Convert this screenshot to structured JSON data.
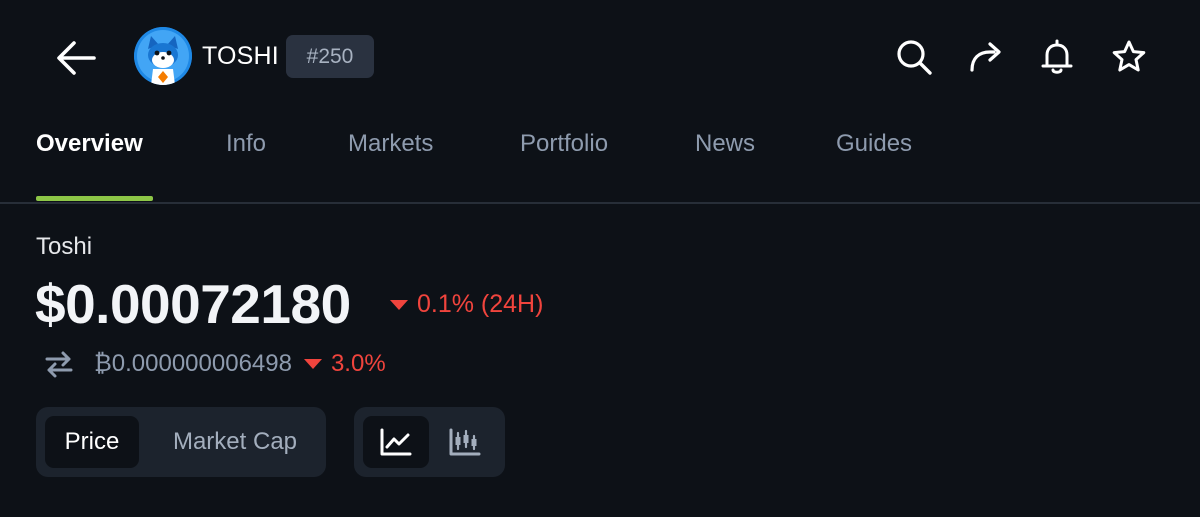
{
  "header": {
    "coin_symbol": "TOSHI",
    "rank": "#250",
    "icons": [
      "back-arrow-icon",
      "search-icon",
      "share-icon",
      "bell-icon",
      "star-icon"
    ]
  },
  "tabs": [
    {
      "label": "Overview",
      "active": true
    },
    {
      "label": "Info",
      "active": false
    },
    {
      "label": "Markets",
      "active": false
    },
    {
      "label": "Portfolio",
      "active": false
    },
    {
      "label": "News",
      "active": false
    },
    {
      "label": "Guides",
      "active": false
    }
  ],
  "price_section": {
    "coin_name": "Toshi",
    "price": "$0.00072180",
    "change_24h": "0.1% (24H)",
    "btc_price": "₿0.000000006498",
    "btc_change": "3.0%"
  },
  "toggles": {
    "metric": {
      "options": [
        "Price",
        "Market Cap"
      ],
      "selected": "Price"
    },
    "chart_type": {
      "options": [
        "line-chart-icon",
        "candlestick-chart-icon"
      ],
      "selected": "line-chart-icon"
    }
  },
  "colors": {
    "background": "#0d1117",
    "accent_tab": "#8dc647",
    "negative": "#f0443d",
    "muted_text": "#8e9bae",
    "badge_bg": "#2a3240"
  }
}
